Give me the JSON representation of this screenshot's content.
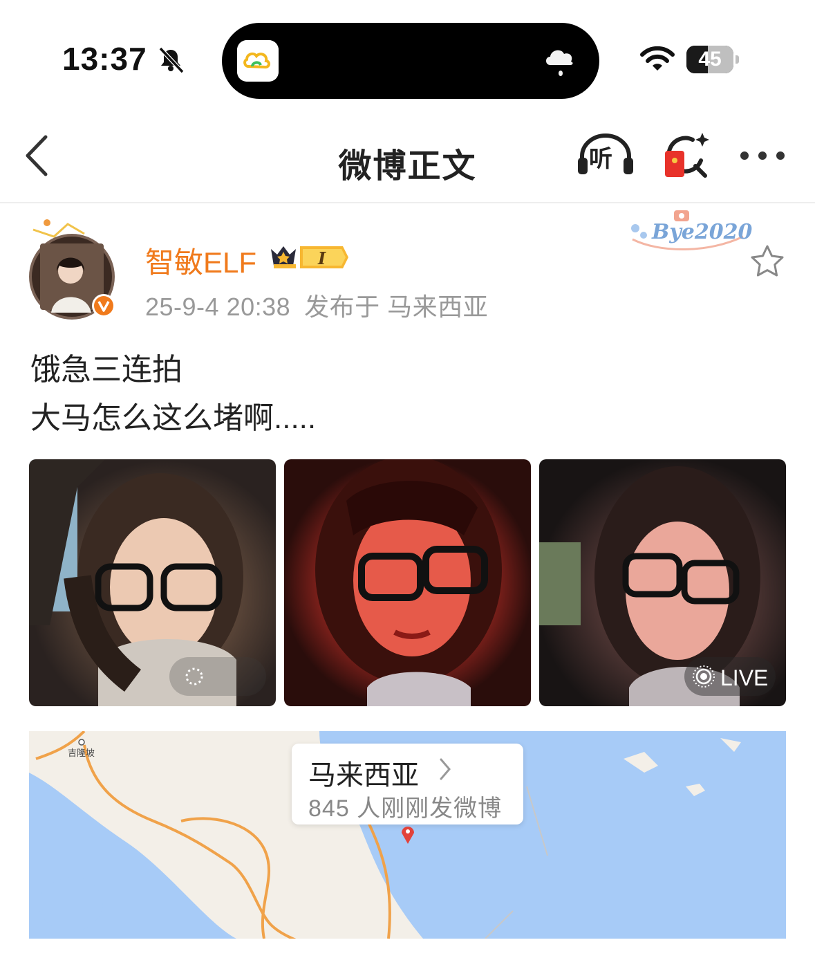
{
  "status_bar": {
    "time": "13:37",
    "battery": "45",
    "battery_level": 0.45
  },
  "nav": {
    "title": "微博正文",
    "listen_label": "听"
  },
  "post": {
    "username": "智敏ELF",
    "member_badge": "I",
    "timestamp": "25-9-4 20:38",
    "location_text": "发布于 马来西亚",
    "decoration_text": "Bye2020",
    "content_lines": [
      "饿急三连拍",
      "大马怎么这么堵啊....."
    ],
    "images": [
      {
        "alt": "selfie-1"
      },
      {
        "alt": "selfie-2"
      },
      {
        "alt": "selfie-3",
        "badge": "LIVE"
      }
    ]
  },
  "map": {
    "city_label": "吉隆坡",
    "card_title": "马来西亚",
    "card_subtitle": "845 人刚刚发微博"
  },
  "colors": {
    "accent": "#f07a1c",
    "map_water": "#a7cbf7",
    "map_land": "#f3efe8",
    "road": "#f0a24a"
  }
}
